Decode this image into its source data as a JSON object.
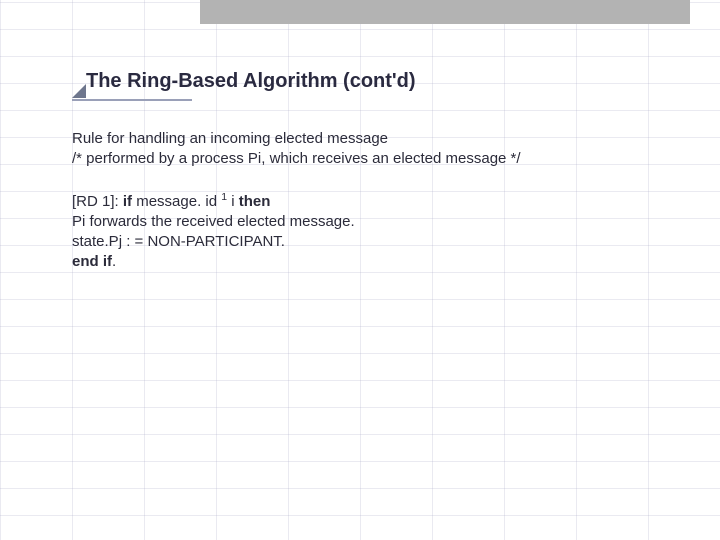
{
  "title": "The Ring-Based Algorithm (cont'd)",
  "intro": {
    "line1": "Rule for handling an incoming elected message",
    "line2": "/* performed by a process Pi, which receives an elected message */"
  },
  "rule": {
    "label": "[RD 1]: ",
    "kw_if": "if",
    "cond_prefix": " message. id ",
    "cond_sup": "1",
    "cond_i": " i ",
    "kw_then": "then",
    "line2": "Pi forwards the received elected message.",
    "line3": "state.Pj : = NON-PARTICIPANT.",
    "kw_endif": "end if"
  }
}
